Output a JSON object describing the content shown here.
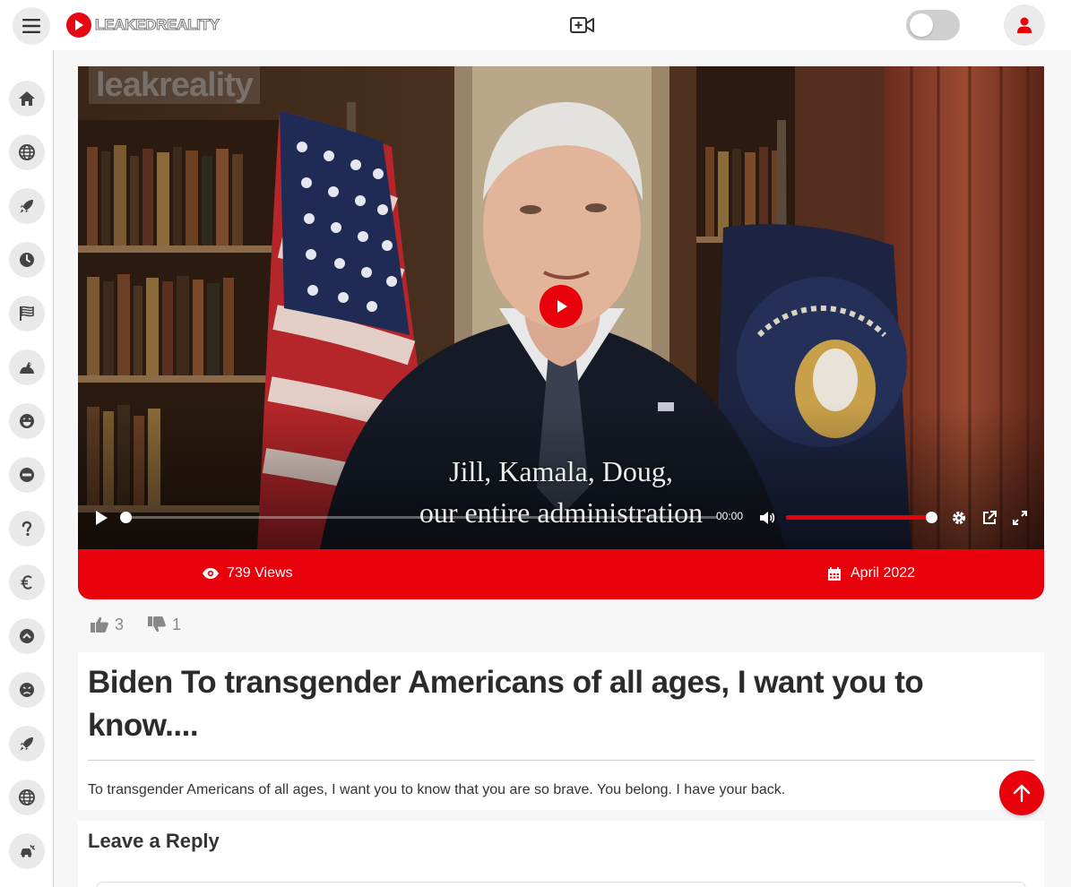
{
  "header": {
    "logo_text": "LEAKEDREALITY",
    "brand_color": "#e8000b"
  },
  "sidebar": {
    "items": [
      {
        "icon": "home-icon"
      },
      {
        "icon": "globe-icon"
      },
      {
        "icon": "rocket-icon"
      },
      {
        "icon": "clock-icon"
      },
      {
        "icon": "flag-icon"
      },
      {
        "icon": "crocodile-icon"
      },
      {
        "icon": "laughing-face-icon"
      },
      {
        "icon": "minus-circle-icon"
      },
      {
        "icon": "question-icon"
      },
      {
        "icon": "euro-icon"
      },
      {
        "icon": "chevron-up-circle-icon"
      },
      {
        "icon": "angry-face-icon"
      },
      {
        "icon": "rocket-icon"
      },
      {
        "icon": "globe-icon"
      },
      {
        "icon": "car-crash-icon"
      }
    ]
  },
  "video": {
    "watermark": "leakreality",
    "caption_line1": "Jill, Kamala, Doug,",
    "caption_line2": "our entire administration",
    "time": "00:00",
    "views": "739 Views",
    "date": "April 2022"
  },
  "rating": {
    "likes": "3",
    "dislikes": "1"
  },
  "article": {
    "title": "Biden To transgender Americans of all ages, I want you to know....",
    "description": "To transgender Americans of all ages, I want you to know that you are so brave. You belong. I have your back."
  },
  "reply": {
    "title": "Leave a Reply"
  }
}
